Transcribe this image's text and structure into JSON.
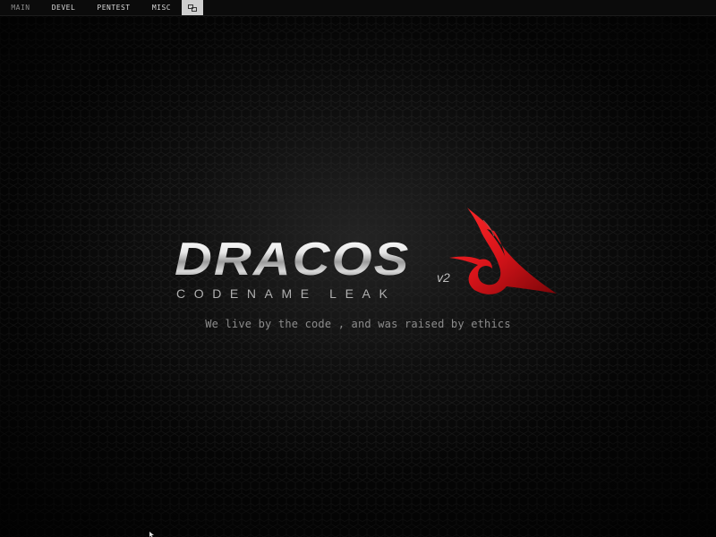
{
  "taskbar": {
    "workspaces": [
      {
        "label": "MAIN",
        "active": false
      },
      {
        "label": "DEVEL",
        "active": false
      },
      {
        "label": "PENTEST",
        "active": false
      },
      {
        "label": "MISC",
        "active": false
      }
    ],
    "layout_icon": "tile-layout-icon"
  },
  "wallpaper": {
    "logo_title": "DRACOS",
    "logo_version": "v2",
    "logo_subtitle": "CODENAME LEAK",
    "tagline": "We live by the code , and was raised by ethics"
  },
  "colors": {
    "background": "#070707",
    "accent_red": "#d8141a",
    "taskbar": "#0b0b0b",
    "layout_button": "#cfcfcf"
  }
}
